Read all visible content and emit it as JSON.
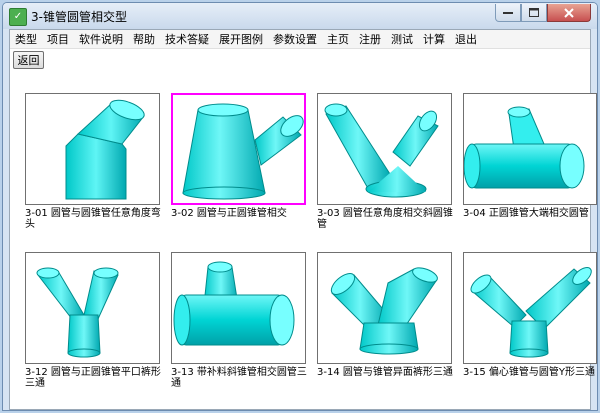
{
  "window": {
    "title": "3-锥管圆管相交型"
  },
  "menu": [
    "类型",
    "项目",
    "软件说明",
    "帮助",
    "技术答疑",
    "展开图例",
    "参数设置",
    "主页",
    "注册",
    "测试",
    "计算",
    "退出"
  ],
  "back_label": "返回",
  "accent": "#ff00ff",
  "shape_color": "#00e0e0",
  "items": [
    {
      "caption": "3-01  圆管与圆锥管任意角度弯头",
      "icon": "elbow-tube-icon",
      "selected": false
    },
    {
      "caption": "3-02  圆管与正圆锥管相交",
      "icon": "cone-with-branch-icon",
      "selected": true
    },
    {
      "caption": "3-03  圆管任意角度相交斜圆锥管",
      "icon": "oblique-cone-branch-icon",
      "selected": false
    },
    {
      "caption": "3-04  正圆锥管大端相交圆管",
      "icon": "cone-tee-icon",
      "selected": false
    },
    {
      "caption": "3-12  圆管与正圆锥管平口裤形三通",
      "icon": "pants-tee-icon",
      "selected": false
    },
    {
      "caption": "3-13  带补料斜锥管相交圆管三通",
      "icon": "cylinder-tee-icon",
      "selected": false
    },
    {
      "caption": "3-14  圆管与锥管异面裤形三通",
      "icon": "y-branch-icon",
      "selected": false
    },
    {
      "caption": "3-15  偏心锥管与圆管Y形三通",
      "icon": "y-tee-icon",
      "selected": false
    }
  ]
}
